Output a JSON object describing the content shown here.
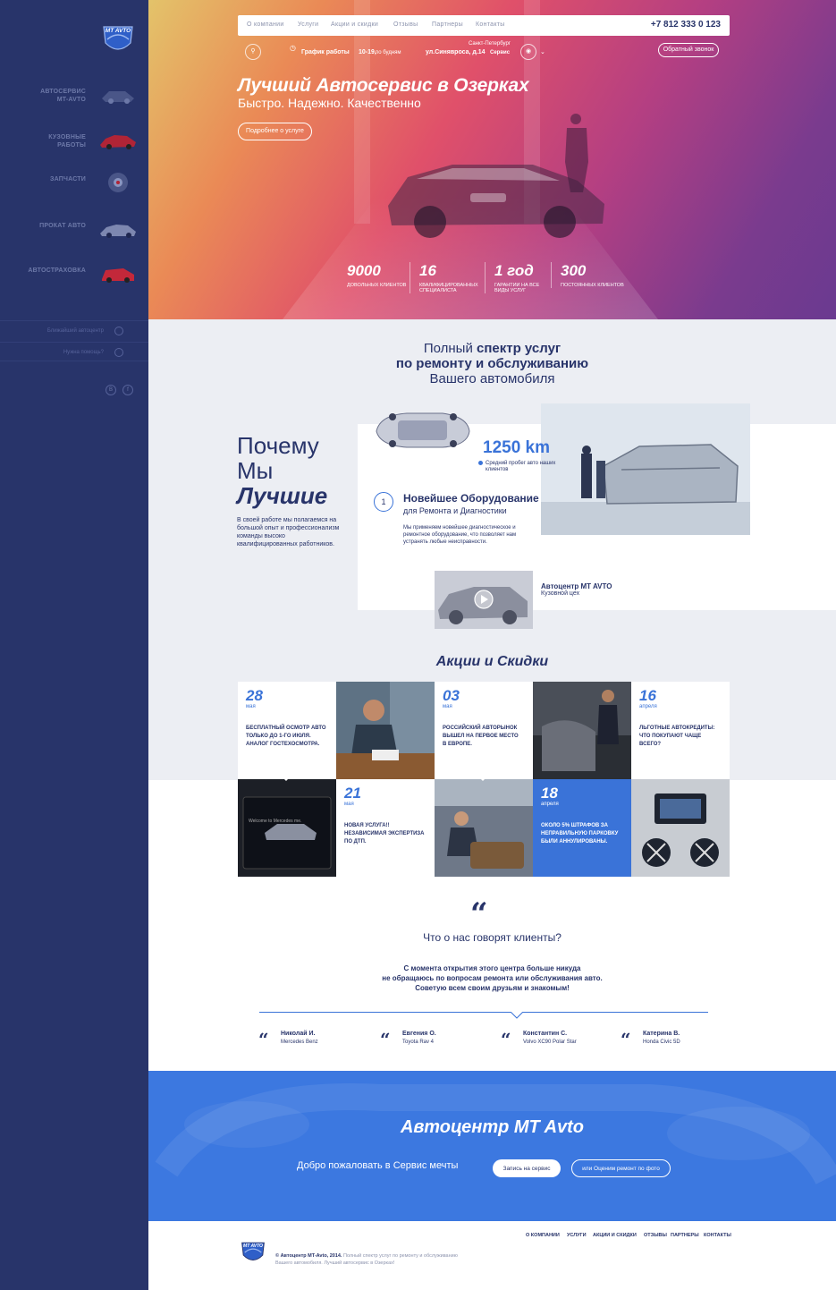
{
  "sidebar": {
    "items": [
      {
        "label": "Автосервис MT-AVTO"
      },
      {
        "label": "Кузовные работы"
      },
      {
        "label": "Запчасти"
      },
      {
        "label": "Прокат авто"
      },
      {
        "label": "Автостраховка"
      }
    ],
    "links": [
      {
        "label": "Ближайший автоцентр"
      },
      {
        "label": "Нужна помощь?"
      }
    ],
    "social": [
      "В",
      "f"
    ]
  },
  "logo": {
    "text": "MT AVTO"
  },
  "nav": {
    "items": [
      "О компании",
      "Услуги",
      "Акции и скидки",
      "Отзывы",
      "Партнеры",
      "Контакты"
    ],
    "phone": "+7 812 333 0 123"
  },
  "subbar": {
    "schedule_label": "График работы",
    "schedule_hours": "10-19,",
    "schedule_days": "по будням",
    "city": "Санкт-Петербург",
    "address": "ул.Синявроса, д.14",
    "service": "Сервис",
    "callback": "Обратный звонок"
  },
  "hero": {
    "title": "Лучший Автосервис в Озерках",
    "subtitle": "Быстро. Надежно. Качественно",
    "cta": "Подробнее о услуге",
    "stats": [
      {
        "value": "9000",
        "label": "довольных клиентов"
      },
      {
        "value": "16",
        "label": "квалифицированных специалиста"
      },
      {
        "value": "1 год",
        "label": "гарантии на все виды услуг"
      },
      {
        "value": "300",
        "label": "постоянных клиентов"
      }
    ]
  },
  "services": {
    "line1_a": "Полный ",
    "line1_b": "спектр услуг",
    "line2": "по ремонту и обслуживанию",
    "line3": "Вашего автомобиля"
  },
  "why": {
    "l1": "Почему",
    "l2": "Мы",
    "l3": "Лучшие",
    "text": "В своей работе мы полагаемся на большой опыт и профессионализм команды высоко квалифицированных работников.",
    "km": "1250 km",
    "km_caption": "Средний пробег авто наших клиентов",
    "number": "1",
    "eq_title": "Новейшее Оборудование",
    "eq_sub": "для Ремонта и Диагностики",
    "eq_text": "Мы применяем новейшее диагностическое и ремонтное оборудование, что позволяет нам устранять любые неисправности.",
    "center_name": "Автоцентр MT AVTO",
    "center_sub": "Кузовной цех"
  },
  "promos": {
    "title": "Акции и Скидки",
    "items": [
      {
        "day": "28",
        "month": "мая",
        "text": "Бесплатный осмотр авто только до 1-го июля. Аналог гостехосмотра."
      },
      {
        "day": "03",
        "month": "мая",
        "text": "Российский авторынок вышел на первое место в Европе."
      },
      {
        "day": "16",
        "month": "апреля",
        "text": "Льготные автокредиты: что покупают чаще всего?"
      },
      {
        "day": "21",
        "month": "мая",
        "text": "Новая услуга!! Независимая экспертиза по ДТП."
      },
      {
        "day": "18",
        "month": "апреля",
        "text": "Около 5% штрафов за неправильную парковку были аннулированы."
      }
    ],
    "screen_text": "Welcome to Mercedes me."
  },
  "reviews": {
    "title": "Что о нас говорят клиенты?",
    "quote_l1": "С момента открытия этого центра больше никуда",
    "quote_l2": "не обращаюсь по вопросам ремонта или обслуживания авто.",
    "quote_l3": "Советую всем своим друзьям и знакомым!",
    "items": [
      {
        "name": "Николай И.",
        "car": "Mercedes Benz"
      },
      {
        "name": "Евгения О.",
        "car": "Toyota Rav 4"
      },
      {
        "name": "Константин С.",
        "car": "Volvo XC90 Polar Star"
      },
      {
        "name": "Катерина В.",
        "car": "Honda Civic 5D"
      }
    ]
  },
  "cta": {
    "title": "Автоцентр MT Avto",
    "subtitle": "Добро пожаловать в Сервис мечты",
    "btn1": "Запись на сервис",
    "btn2": "или Оценим ремонт по фото"
  },
  "footer": {
    "copy_bold": "© Автоцентр MT-Avto, 2014.",
    "copy_text": " Полный спектр услуг по ремонту и обслуживанию Вашего автомобиля. Лучший автосервис в Озерках!",
    "nav": [
      "О компании",
      "Услуги",
      "Акции и скидки",
      "Отзывы",
      "Партнеры",
      "Контакты"
    ]
  },
  "colors": {
    "sidebar": "#28346a",
    "accent": "#3a73d8",
    "navy": "#28346a",
    "cta_bg": "#3c78e0"
  }
}
